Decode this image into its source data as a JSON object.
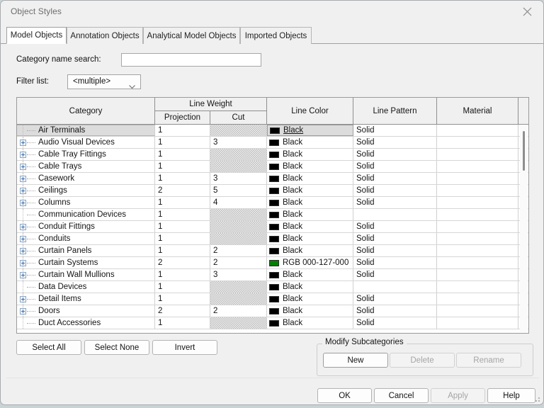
{
  "window": {
    "title": "Object Styles",
    "close_icon": "close-icon"
  },
  "tabs": [
    {
      "label": "Model Objects",
      "active": true
    },
    {
      "label": "Annotation Objects",
      "active": false
    },
    {
      "label": "Analytical Model Objects",
      "active": false
    },
    {
      "label": "Imported Objects",
      "active": false
    }
  ],
  "form": {
    "search_label": "Category name search:",
    "search_value": "",
    "search_placeholder": "",
    "filter_label": "Filter list:",
    "filter_value": "<multiple>",
    "filter_options": [
      "<multiple>"
    ]
  },
  "grid": {
    "headers": {
      "category": "Category",
      "line_weight": "Line Weight",
      "projection": "Projection",
      "cut": "Cut",
      "line_color": "Line Color",
      "line_pattern": "Line Pattern",
      "material": "Material"
    },
    "rows": [
      {
        "category": "Air Terminals",
        "expandable": false,
        "projection": "1",
        "cut": "",
        "cut_disabled": true,
        "color": "Black",
        "color_hex": "#000000",
        "pattern": "Solid",
        "material": "",
        "selected": true
      },
      {
        "category": "Audio Visual Devices",
        "expandable": true,
        "projection": "1",
        "cut": "3",
        "cut_disabled": false,
        "color": "Black",
        "color_hex": "#000000",
        "pattern": "Solid",
        "material": "",
        "selected": false
      },
      {
        "category": "Cable Tray Fittings",
        "expandable": true,
        "projection": "1",
        "cut": "",
        "cut_disabled": true,
        "color": "Black",
        "color_hex": "#000000",
        "pattern": "Solid",
        "material": "",
        "selected": false
      },
      {
        "category": "Cable Trays",
        "expandable": true,
        "projection": "1",
        "cut": "",
        "cut_disabled": true,
        "color": "Black",
        "color_hex": "#000000",
        "pattern": "Solid",
        "material": "",
        "selected": false
      },
      {
        "category": "Casework",
        "expandable": true,
        "projection": "1",
        "cut": "3",
        "cut_disabled": false,
        "color": "Black",
        "color_hex": "#000000",
        "pattern": "Solid",
        "material": "",
        "selected": false
      },
      {
        "category": "Ceilings",
        "expandable": true,
        "projection": "2",
        "cut": "5",
        "cut_disabled": false,
        "color": "Black",
        "color_hex": "#000000",
        "pattern": "Solid",
        "material": "",
        "selected": false
      },
      {
        "category": "Columns",
        "expandable": true,
        "projection": "1",
        "cut": "4",
        "cut_disabled": false,
        "color": "Black",
        "color_hex": "#000000",
        "pattern": "Solid",
        "material": "",
        "selected": false
      },
      {
        "category": "Communication Devices",
        "expandable": false,
        "projection": "1",
        "cut": "",
        "cut_disabled": true,
        "color": "Black",
        "color_hex": "#000000",
        "pattern": "",
        "material": "",
        "selected": false
      },
      {
        "category": "Conduit Fittings",
        "expandable": true,
        "projection": "1",
        "cut": "",
        "cut_disabled": true,
        "color": "Black",
        "color_hex": "#000000",
        "pattern": "Solid",
        "material": "",
        "selected": false
      },
      {
        "category": "Conduits",
        "expandable": true,
        "projection": "1",
        "cut": "",
        "cut_disabled": true,
        "color": "Black",
        "color_hex": "#000000",
        "pattern": "Solid",
        "material": "",
        "selected": false
      },
      {
        "category": "Curtain Panels",
        "expandable": true,
        "projection": "1",
        "cut": "2",
        "cut_disabled": false,
        "color": "Black",
        "color_hex": "#000000",
        "pattern": "Solid",
        "material": "",
        "selected": false
      },
      {
        "category": "Curtain Systems",
        "expandable": true,
        "projection": "2",
        "cut": "2",
        "cut_disabled": false,
        "color": "RGB 000-127-000",
        "color_hex": "#007f00",
        "pattern": "Solid",
        "material": "",
        "selected": false
      },
      {
        "category": "Curtain Wall Mullions",
        "expandable": true,
        "projection": "1",
        "cut": "3",
        "cut_disabled": false,
        "color": "Black",
        "color_hex": "#000000",
        "pattern": "Solid",
        "material": "",
        "selected": false
      },
      {
        "category": "Data Devices",
        "expandable": false,
        "projection": "1",
        "cut": "",
        "cut_disabled": true,
        "color": "Black",
        "color_hex": "#000000",
        "pattern": "",
        "material": "",
        "selected": false
      },
      {
        "category": "Detail Items",
        "expandable": true,
        "projection": "1",
        "cut": "",
        "cut_disabled": true,
        "color": "Black",
        "color_hex": "#000000",
        "pattern": "Solid",
        "material": "",
        "selected": false
      },
      {
        "category": "Doors",
        "expandable": true,
        "projection": "2",
        "cut": "2",
        "cut_disabled": false,
        "color": "Black",
        "color_hex": "#000000",
        "pattern": "Solid",
        "material": "",
        "selected": false
      },
      {
        "category": "Duct Accessories",
        "expandable": false,
        "projection": "1",
        "cut": "",
        "cut_disabled": true,
        "color": "Black",
        "color_hex": "#000000",
        "pattern": "Solid",
        "material": "",
        "selected": false
      }
    ]
  },
  "selection_buttons": [
    {
      "label": "Select All",
      "disabled": false
    },
    {
      "label": "Select None",
      "disabled": false
    },
    {
      "label": "Invert",
      "disabled": false
    }
  ],
  "modify_subcategories": {
    "legend": "Modify Subcategories",
    "buttons": [
      {
        "label": "New",
        "disabled": false
      },
      {
        "label": "Delete",
        "disabled": true
      },
      {
        "label": "Rename",
        "disabled": true
      }
    ]
  },
  "dialog_buttons": [
    {
      "label": "OK",
      "disabled": false
    },
    {
      "label": "Cancel",
      "disabled": false
    },
    {
      "label": "Apply",
      "disabled": true
    },
    {
      "label": "Help",
      "disabled": false
    }
  ]
}
